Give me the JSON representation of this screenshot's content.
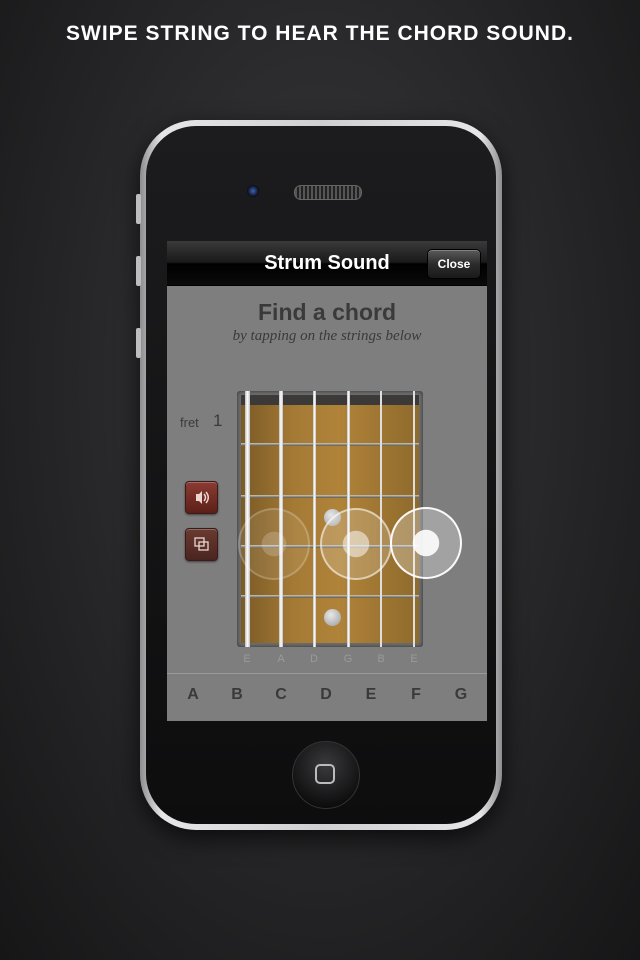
{
  "caption": "SWIPE STRING TO HEAR THE CHORD SOUND.",
  "navbar": {
    "title": "Strum Sound",
    "close_label": "Close"
  },
  "content": {
    "title": "Find a chord",
    "subtitle": "by tapping on the strings below",
    "fret_label": "fret",
    "fret_number": "1"
  },
  "tools": {
    "sound_icon": "speaker-icon",
    "copy_icon": "copy-icon"
  },
  "strings": [
    "E",
    "A",
    "D",
    "G",
    "B",
    "E"
  ],
  "chord_keys": [
    "A",
    "B",
    "C",
    "D",
    "E",
    "F",
    "G"
  ],
  "colors": {
    "background": "#262628",
    "screen": "#7e7e7e",
    "accent_button": "#8a3b32",
    "fretboard": "#b08339"
  }
}
